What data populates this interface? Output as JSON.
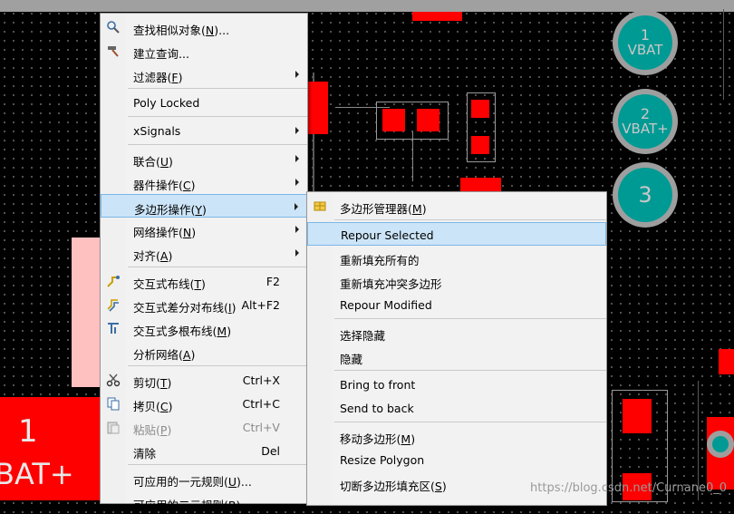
{
  "board": {
    "pad1": {
      "num": "1",
      "name": "VBAT"
    },
    "pad2": {
      "num": "2",
      "name": "VBAT+"
    },
    "pad3": {
      "num": "3"
    },
    "bigpad": {
      "num": "1",
      "name": "BAT+"
    }
  },
  "main_menu": {
    "items": [
      {
        "label": "查找相似对象(N)...",
        "icon": "find-similar-icon"
      },
      {
        "label": "建立查询...",
        "icon": "hammer-icon"
      },
      {
        "label": "过滤器(F)",
        "submenu": true
      },
      {
        "label": "Poly Locked"
      },
      {
        "label": "xSignals",
        "submenu": true
      },
      {
        "label": "联合(U)",
        "submenu": true
      },
      {
        "label": "器件操作(C)",
        "submenu": true
      },
      {
        "label": "多边形操作(Y)",
        "submenu": true,
        "highlighted": true
      },
      {
        "label": "网络操作(N)",
        "submenu": true
      },
      {
        "label": "对齐(A)",
        "submenu": true
      },
      {
        "label": "交互式布线(T)",
        "shortcut": "F2",
        "icon": "route-icon"
      },
      {
        "label": "交互式差分对布线(I)",
        "shortcut": "Alt+F2",
        "icon": "diff-pair-route-icon"
      },
      {
        "label": "交互式多根布线(M)",
        "icon": "multi-route-icon"
      },
      {
        "label": "分析网络(A)"
      },
      {
        "label": "剪切(T)",
        "shortcut": "Ctrl+X",
        "icon": "scissors-icon"
      },
      {
        "label": "拷贝(C)",
        "shortcut": "Ctrl+C",
        "icon": "copy-icon"
      },
      {
        "label": "粘贴(P)",
        "shortcut": "Ctrl+V",
        "icon": "paste-icon",
        "disabled": true
      },
      {
        "label": "清除",
        "shortcut": "Del"
      },
      {
        "label": "可应用的一元规则(U)..."
      },
      {
        "label": "可应用的二元规则(B)..."
      }
    ]
  },
  "sub_menu": {
    "items": [
      {
        "label": "多边形管理器(M)",
        "icon": "polygon-manager-icon"
      },
      {
        "label": "Repour Selected",
        "highlighted": true
      },
      {
        "label": "重新填充所有的"
      },
      {
        "label": "重新填充冲突多边形"
      },
      {
        "label": "Repour Modified"
      },
      {
        "label": "选择隐藏"
      },
      {
        "label": "隐藏"
      },
      {
        "label": "Bring to front"
      },
      {
        "label": "Send to back"
      },
      {
        "label": "移动多边形(M)"
      },
      {
        "label": "Resize Polygon"
      },
      {
        "label": "切断多边形填充区(S)"
      }
    ]
  },
  "watermark": "https://blog.csdn.net/Curnane0_0",
  "colors": {
    "copper": "#ff0000",
    "pad_teal": "#009a94",
    "menu_highlight": "#cce4f7"
  }
}
